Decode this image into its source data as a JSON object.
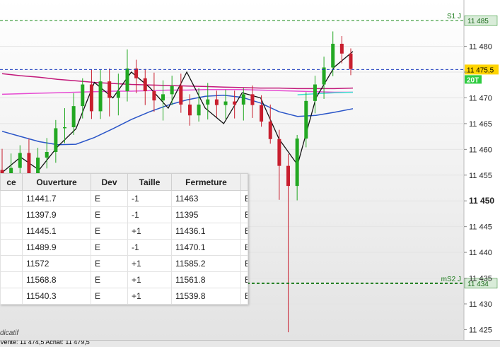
{
  "chart_data": {
    "type": "candlestick",
    "instrument_hint": "",
    "y_axis": {
      "ticks": [
        11480,
        11475,
        11470,
        11465,
        11460,
        11455,
        11450,
        11445,
        11440,
        11435,
        11430,
        11425
      ],
      "tick_labels": [
        "11 480",
        "",
        "11 470",
        "11 465",
        "11 460",
        "11 455",
        "11 450",
        "11 445",
        "11 440",
        "11 435",
        "11 430",
        "11 425"
      ],
      "bold_tick": 11450,
      "ylim": [
        11423,
        11489
      ]
    },
    "levels": [
      {
        "name": "S1 J",
        "value": 11485,
        "label": "11 485",
        "color": "#1a8a1a",
        "style": "dashed"
      },
      {
        "name": "mS2 J",
        "value": 11434,
        "label": "11 434",
        "color": "#1a7a1a",
        "style": "dashed"
      }
    ],
    "last_price": {
      "value": 11475.5,
      "label": "11 475,5",
      "color": "#1f3fbf",
      "tag_color": "#ffd400"
    },
    "timeframe_tag": {
      "label": "20T",
      "color": "#2ecc40"
    },
    "moving_averages": [
      {
        "color": "#c2187a",
        "values": [
          11474.7,
          11474.3,
          11474.0,
          11473.6,
          11473.3,
          11473.0,
          11472.8,
          11472.6,
          11472.5,
          11472.4,
          11472.3,
          11472.2,
          11472.1,
          11472.0,
          11471.9,
          11471.9,
          11471.8,
          11471.8,
          11471.8,
          11471.9
        ]
      },
      {
        "color": "#e64cd2",
        "values": [
          11470.7,
          11470.8,
          11470.9,
          11471.0,
          11471.1,
          11471.2,
          11471.3,
          11471.3,
          11471.4,
          11471.5,
          11471.5,
          11471.6,
          11471.6,
          11471.6,
          11471.5,
          11471.4,
          11471.3,
          11471.2,
          11471.1,
          11471.1
        ]
      },
      {
        "color": "#2a55c8",
        "values": [
          11463.5,
          11462.5,
          11461.5,
          11460.9,
          11461.0,
          11462.3,
          11464.0,
          11465.8,
          11467.3,
          11468.6,
          11469.6,
          11470.3,
          11470.5,
          11470.1,
          11469.0,
          11467.3,
          11466.4,
          11466.6,
          11467.2,
          11467.9
        ]
      },
      {
        "color": "#40e0d0",
        "values": [
          null,
          null,
          null,
          null,
          null,
          null,
          null,
          null,
          null,
          null,
          null,
          null,
          null,
          null,
          null,
          null,
          11470.6,
          11470.8,
          11471.0,
          11471.1
        ]
      },
      {
        "color": "#111111",
        "values": [
          11455.5,
          11458.5,
          11456.0,
          11460.5,
          11464.0,
          11473.0,
          11470.0,
          11475.0,
          11472.0,
          11468.0,
          11475.0,
          11468.0,
          11465.0,
          11471.0,
          11470.0,
          11462.0,
          11457.0,
          11470.0,
          11476.0,
          11479.0
        ]
      }
    ],
    "candles": [
      [
        11456.0,
        11460.1,
        11452.6,
        11453.7
      ],
      [
        11454.5,
        11459.2,
        11452.4,
        11456.4
      ],
      [
        11456.4,
        11460.8,
        11454.8,
        11459.3
      ],
      [
        11459.3,
        11462.1,
        11454.0,
        11455.1
      ],
      [
        11455.1,
        11460.3,
        11452.9,
        11458.4
      ],
      [
        11458.4,
        11462.2,
        11456.3,
        11459.5
      ],
      [
        11459.5,
        11465.7,
        11457.4,
        11464.1
      ],
      [
        11464.1,
        11468.0,
        11461.2,
        11464.3
      ],
      [
        11464.3,
        11470.9,
        11462.8,
        11468.4
      ],
      [
        11468.4,
        11473.8,
        11466.0,
        11472.6
      ],
      [
        11472.6,
        11475.5,
        11465.9,
        11467.4
      ],
      [
        11467.4,
        11475.5,
        11465.9,
        11473.2
      ],
      [
        11473.2,
        11475.7,
        11466.4,
        11470.0
      ],
      [
        11470.0,
        11474.7,
        11466.6,
        11471.3
      ],
      [
        11471.3,
        11479.4,
        11469.3,
        11475.7
      ],
      [
        11475.7,
        11477.4,
        11470.9,
        11473.8
      ],
      [
        11473.8,
        11475.6,
        11468.6,
        11471.3
      ],
      [
        11471.3,
        11474.9,
        11467.3,
        11469.5
      ],
      [
        11469.5,
        11473.4,
        11465.6,
        11470.7
      ],
      [
        11470.7,
        11474.3,
        11468.6,
        11472.3
      ],
      [
        11472.3,
        11474.7,
        11467.1,
        11468.7
      ],
      [
        11468.7,
        11470.7,
        11464.6,
        11466.6
      ],
      [
        11466.6,
        11471.9,
        11465.4,
        11468.7
      ],
      [
        11468.7,
        11472.9,
        11465.8,
        11469.7
      ],
      [
        11469.7,
        11471.4,
        11466.3,
        11468.6
      ],
      [
        11468.6,
        11471.6,
        11465.9,
        11469.3
      ],
      [
        11469.3,
        11471.4,
        11466.0,
        11468.7
      ],
      [
        11468.7,
        11471.9,
        11465.6,
        11470.7
      ],
      [
        11470.7,
        11472.4,
        11466.1,
        11468.6
      ],
      [
        11468.6,
        11470.5,
        11464.4,
        11465.4
      ],
      [
        11465.4,
        11468.7,
        11461.1,
        11462.0
      ],
      [
        11462.0,
        11463.8,
        11450.2,
        11456.8
      ],
      [
        11456.8,
        11459.1,
        11424.5,
        11452.9
      ],
      [
        11452.9,
        11462.8,
        11450.1,
        11462.1
      ],
      [
        11462.1,
        11471.1,
        11460.4,
        11469.4
      ],
      [
        11469.4,
        11474.3,
        11467.0,
        11472.6
      ],
      [
        11472.6,
        11478.0,
        11469.8,
        11475.9
      ],
      [
        11475.9,
        11482.9,
        11474.2,
        11480.5
      ],
      [
        11480.5,
        11482.0,
        11476.7,
        11478.6
      ],
      [
        11478.6,
        11479.6,
        11474.4,
        11475.6
      ]
    ]
  },
  "trades_table": {
    "headers": [
      "ce",
      "Ouverture",
      "Dev",
      "Taille",
      "Fermeture",
      ""
    ],
    "rows": [
      {
        "c0": "",
        "ouverture": "11441.7",
        "dev": "E",
        "taille": "-1",
        "fermeture": "11463",
        "c5": "E",
        "highlight": true
      },
      {
        "c0": "",
        "ouverture": "11397.9",
        "dev": "E",
        "taille": "-1",
        "fermeture": "11395",
        "c5": "E",
        "highlight": false
      },
      {
        "c0": "",
        "ouverture": "11445.1",
        "dev": "E",
        "taille": "+1",
        "fermeture": "11436.1",
        "c5": "E",
        "highlight": false
      },
      {
        "c0": "",
        "ouverture": "11489.9",
        "dev": "E",
        "taille": "-1",
        "fermeture": "11470.1",
        "c5": "E",
        "highlight": false
      },
      {
        "c0": "",
        "ouverture": "11572",
        "dev": "E",
        "taille": "+1",
        "fermeture": "11585.2",
        "c5": "E",
        "highlight": false
      },
      {
        "c0": "",
        "ouverture": "11568.8",
        "dev": "E",
        "taille": "+1",
        "fermeture": "11561.8",
        "c5": "E",
        "highlight": false
      },
      {
        "c0": "",
        "ouverture": "11540.3",
        "dev": "E",
        "taille": "+1",
        "fermeture": "11539.8",
        "c5": "E",
        "highlight": false
      }
    ],
    "highlight_color": "#fff200"
  },
  "footer": {
    "indicatif_label": "dicatif",
    "status_text": "Vente: 11 474,5   Achat: 11 479,5"
  },
  "colors": {
    "up_candle": "#22a822",
    "down_candle": "#c81e2e",
    "grid": "#e4e4e4",
    "chart_bg_bottom": "#e6e6e6"
  }
}
